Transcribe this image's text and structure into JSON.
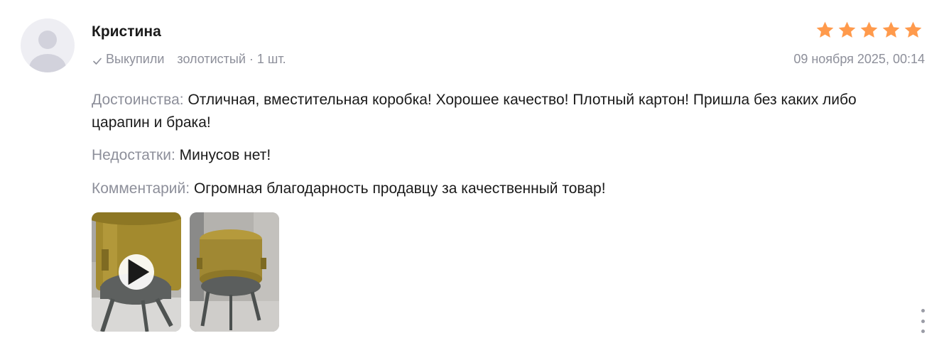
{
  "review": {
    "author": "Кристина",
    "purchase_status": "Выкупили",
    "variant": "золотистый · 1 шт.",
    "date": "09 ноября 2025, 00:14",
    "rating": 5,
    "rating_max": 5,
    "star_color": "#ff9a4c",
    "pros_label": "Достоинства:",
    "pros_text": "Отличная, вместительная коробка! Хорошее качество! Плотный картон! Пришла без каких либо царапин и брака!",
    "cons_label": "Недостатки:",
    "cons_text": "Минусов нет!",
    "comment_label": "Комментарий:",
    "comment_text": "Огромная благодарность продавцу за качественный товар!",
    "media": [
      {
        "type": "video",
        "icon": "play-icon",
        "description_icon": "photo-thumbnail"
      },
      {
        "type": "photo",
        "description_icon": "photo-thumbnail"
      }
    ],
    "more_icon": "more-vertical-icon"
  }
}
